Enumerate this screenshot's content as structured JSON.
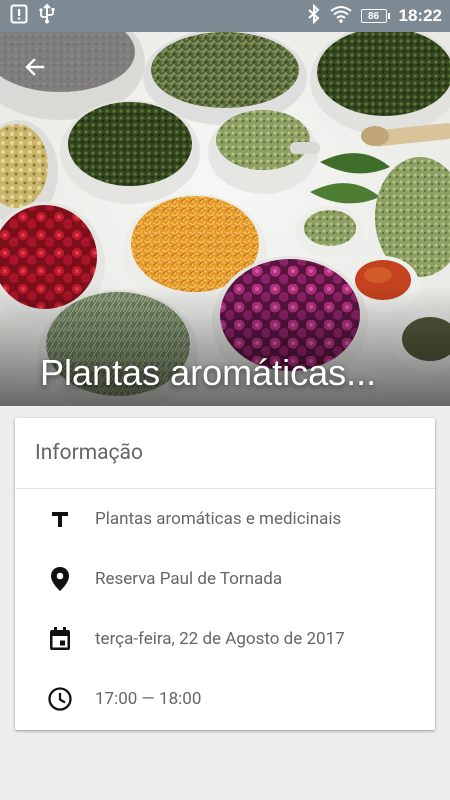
{
  "status_bar": {
    "time": "18:22",
    "battery": "86",
    "icons": [
      "alert-icon",
      "usb-icon",
      "bluetooth-icon",
      "wifi-icon",
      "battery-icon"
    ]
  },
  "hero": {
    "title": "Plantas aromáticas...",
    "back_icon": "arrow-back-icon"
  },
  "card": {
    "header": "Informação",
    "rows": [
      {
        "icon": "title-icon",
        "text": "Plantas aromáticas e medicinais"
      },
      {
        "icon": "location-pin-icon",
        "text": "Reserva Paul de Tornada"
      },
      {
        "icon": "calendar-icon",
        "text": "terça-feira, 22 de Agosto de 2017"
      },
      {
        "icon": "clock-icon",
        "text": "17:00 — 18:00"
      }
    ]
  },
  "colors": {
    "status_bar": "#7d8a93",
    "background": "#eeeeee",
    "card": "#ffffff",
    "text_secondary": "#666666"
  }
}
